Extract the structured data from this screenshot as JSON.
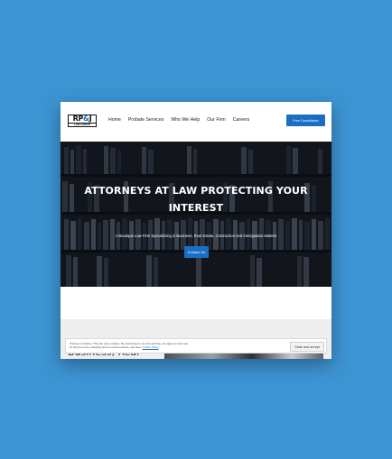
{
  "colors": {
    "background": "#3d94d2",
    "accent": "#1a6fc4",
    "hero_dark": "#1b1f26"
  },
  "header": {
    "logo_main_left": "RP",
    "logo_amp": "&",
    "logo_main_right": "J",
    "logo_sub": "LAW GROUP",
    "nav": [
      "Home",
      "Probate Services",
      "Who We Help",
      "Our Firm",
      "Careers"
    ],
    "cta_label": "Free Consultation"
  },
  "hero": {
    "title_line1": "ATTORNEYS AT LAW PROTECTING YOUR",
    "title_line2": "INTEREST",
    "subtitle": "A Boutique Law Firm Specializing in Business, Real Estate, Contruction and Immigration Matters",
    "button_label": "Contact Us",
    "background_icon": "bookshelf-image"
  },
  "lower": {
    "heading": "Business, Real"
  },
  "cookie": {
    "line1": "Privacy & Cookies: This site uses cookies. By continuing to use this website, you agree to their use.",
    "line2_prefix": "To find out more, including how to control cookies, see here: ",
    "link_label": "Cookie Policy",
    "button_label": "Close and accept"
  }
}
